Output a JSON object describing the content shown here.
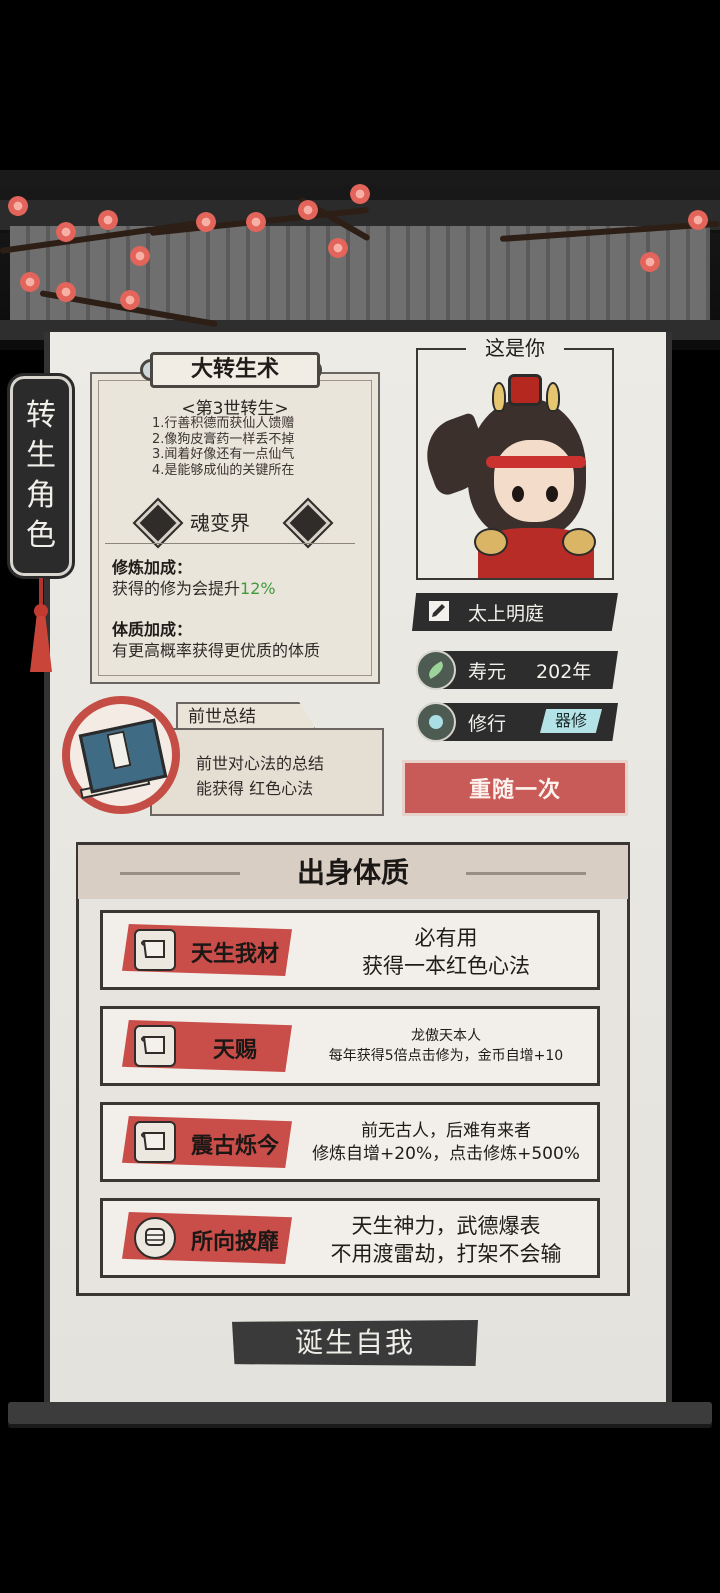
{
  "side_tag": {
    "chars": [
      "转",
      "生",
      "角",
      "色"
    ]
  },
  "rebirth": {
    "title": "大转生术",
    "generation": "<第3世转生>",
    "rules": [
      "1.行善积德而获仙人馈赠",
      "2.像狗皮膏药一样丢不掉",
      "3.闻着好像还有一点仙气",
      "4.是能够成仙的关键所在"
    ],
    "realm": "魂变界",
    "cultivation_label": "修炼加成：",
    "cultivation_text": "获得的修为会提升",
    "cultivation_value": "12%",
    "physique_label": "体质加成：",
    "physique_text": "有更高概率获得更优质的体质"
  },
  "past_life": {
    "tab": "前世总结",
    "line1": "前世对心法的总结",
    "line2": "能获得 红色心法"
  },
  "portrait": {
    "label": "这是你"
  },
  "info": {
    "name": "太上明庭",
    "lifespan_label": "寿元",
    "lifespan_value": "202年",
    "cultivate_label": "修行",
    "cultivate_tag": "器修",
    "reroll": "重随一次"
  },
  "traits": {
    "title": "出身体质",
    "items": [
      {
        "name": "天生我材",
        "icon": "scroll-icon",
        "lines": [
          "必有用",
          "获得一本红色心法"
        ]
      },
      {
        "name": "天赐",
        "icon": "scroll-icon",
        "lines": [
          "龙傲天本人",
          "每年获得5倍点击修为，金币自增+10"
        ]
      },
      {
        "name": "震古烁今",
        "icon": "scroll-icon",
        "lines": [
          "前无古人，后难有来者",
          "修炼自增+20%，点击修炼+500%"
        ]
      },
      {
        "name": "所向披靡",
        "icon": "fist-icon",
        "lines": [
          "天生神力，武德爆表",
          "不用渡雷劫，打架不会输"
        ]
      }
    ]
  },
  "birth_button": "诞生自我",
  "colors": {
    "accent_red": "#c94d48",
    "panel": "#ecebe6",
    "ink": "#2b2b2b",
    "green": "#3f9a3c",
    "tag_cyan": "#b3e3e6"
  }
}
